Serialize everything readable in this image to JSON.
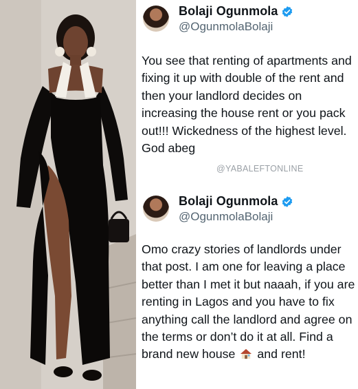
{
  "watermark": "@YABALEFTONLINE",
  "tweets": [
    {
      "name": "Bolaji Ogunmola",
      "handle": "@OgunmolaBolaji",
      "text": "You see that renting of apartments and fixing it up with double of the rent and then your landlord decides on increasing the house rent or you pack out!!! Wickedness of the highest level. God abeg"
    },
    {
      "name": "Bolaji Ogunmola",
      "handle": "@OgunmolaBolaji",
      "text_before_icon": "Omo crazy stories of landlords under that post. I am one for leaving a place better than I met it but naaah, if you are renting in Lagos and you have to fix anything call the landlord and agree on the terms or don’t do it at all. Find a brand new house",
      "text_after_icon": "and rent!"
    }
  ],
  "colors": {
    "verified_badge": "#1d9bf0",
    "name": "#0f1419",
    "handle": "#536471"
  },
  "icons": [
    "verified-badge-icon",
    "house-icon"
  ]
}
